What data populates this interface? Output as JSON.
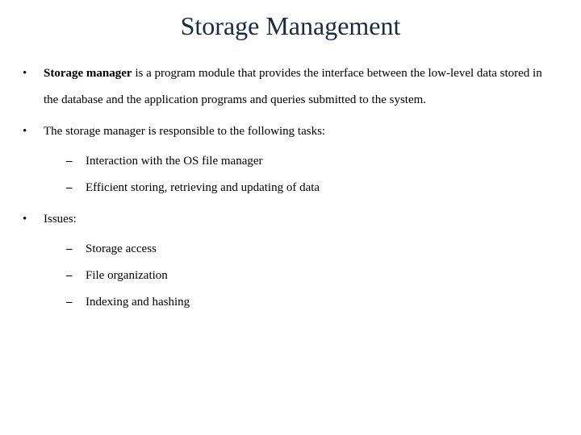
{
  "title": "Storage Management",
  "bullets": [
    {
      "lead_bold": "Storage manager",
      "rest": " is a program module that provides the interface between the low-level data stored in the database and the application programs and queries submitted to the system."
    },
    {
      "text": "The storage manager is responsible to the following tasks:",
      "sub": [
        "Interaction with the OS file manager",
        "Efficient storing, retrieving and updating of data"
      ]
    },
    {
      "text": "Issues:",
      "sub": [
        "Storage access",
        "File organization",
        "Indexing and hashing"
      ]
    }
  ]
}
